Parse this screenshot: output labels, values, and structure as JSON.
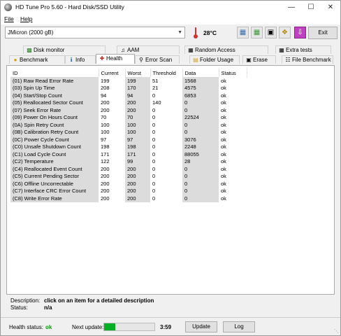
{
  "window": {
    "title": "HD Tune Pro 5.60 - Hard Disk/SSD Utility",
    "min_icon": "minimize-icon",
    "max_icon": "maximize-icon",
    "close_icon": "close-icon"
  },
  "menu": {
    "file": "File",
    "help": "Help"
  },
  "toolbar": {
    "drive": "JMicron  (2000 gB)",
    "temperature": "28°C",
    "exit_label": "Exit",
    "icons": [
      "thermometer-icon",
      "copy-info-icon",
      "copy-text-icon",
      "screenshot-icon",
      "options-icon",
      "save-icon"
    ]
  },
  "tabs": {
    "row1": [
      {
        "label": "Disk monitor",
        "icon": "disk-monitor-icon"
      },
      {
        "label": "AAM",
        "icon": "aam-icon"
      },
      {
        "label": "Random Access",
        "icon": "random-access-icon"
      },
      {
        "label": "Extra tests",
        "icon": "extra-tests-icon"
      }
    ],
    "row2": [
      {
        "label": "Benchmark",
        "icon": "benchmark-icon"
      },
      {
        "label": "Info",
        "icon": "info-icon"
      },
      {
        "label": "Health",
        "icon": "health-icon"
      },
      {
        "label": "Error Scan",
        "icon": "error-scan-icon"
      },
      {
        "label": "Folder Usage",
        "icon": "folder-usage-icon"
      },
      {
        "label": "Erase",
        "icon": "erase-icon"
      },
      {
        "label": "File Benchmark",
        "icon": "file-benchmark-icon"
      }
    ]
  },
  "table": {
    "headers": [
      "ID",
      "Current",
      "Worst",
      "Threshold",
      "Data",
      "Status"
    ],
    "rows": [
      [
        "(01) Raw Read Error Rate",
        "199",
        "199",
        "51",
        "1568",
        "ok"
      ],
      [
        "(03) Spin Up Time",
        "208",
        "170",
        "21",
        "4575",
        "ok"
      ],
      [
        "(04) Start/Stop Count",
        "94",
        "94",
        "0",
        "6853",
        "ok"
      ],
      [
        "(05) Reallocated Sector Count",
        "200",
        "200",
        "140",
        "0",
        "ok"
      ],
      [
        "(07) Seek Error Rate",
        "200",
        "200",
        "0",
        "0",
        "ok"
      ],
      [
        "(09) Power On Hours Count",
        "70",
        "70",
        "0",
        "22524",
        "ok"
      ],
      [
        "(0A) Spin Retry Count",
        "100",
        "100",
        "0",
        "0",
        "ok"
      ],
      [
        "(0B) Calibration Retry Count",
        "100",
        "100",
        "0",
        "0",
        "ok"
      ],
      [
        "(0C) Power Cycle Count",
        "97",
        "97",
        "0",
        "3076",
        "ok"
      ],
      [
        "(C0) Unsafe Shutdown Count",
        "198",
        "198",
        "0",
        "2248",
        "ok"
      ],
      [
        "(C1) Load Cycle Count",
        "171",
        "171",
        "0",
        "88055",
        "ok"
      ],
      [
        "(C2) Temperature",
        "122",
        "99",
        "0",
        "28",
        "ok"
      ],
      [
        "(C4) Reallocated Event Count",
        "200",
        "200",
        "0",
        "0",
        "ok"
      ],
      [
        "(C5) Current Pending Sector",
        "200",
        "200",
        "0",
        "0",
        "ok"
      ],
      [
        "(C6) Offline Uncorrectable",
        "200",
        "200",
        "0",
        "0",
        "ok"
      ],
      [
        "(C7) Interface CRC Error Count",
        "200",
        "200",
        "0",
        "0",
        "ok"
      ],
      [
        "(C8) Write Error Rate",
        "200",
        "200",
        "0",
        "0",
        "ok"
      ]
    ]
  },
  "description": {
    "label": "Description:",
    "value": "click on an item for a detailed description",
    "status_label": "Status:",
    "status_value": "n/a"
  },
  "statusbar": {
    "health_label": "Health status:",
    "health_value": "ok",
    "next_update_label": "Next update:",
    "progress_fraction": 0.22,
    "time": "3:59",
    "update_label": "Update",
    "log_label": "Log"
  }
}
